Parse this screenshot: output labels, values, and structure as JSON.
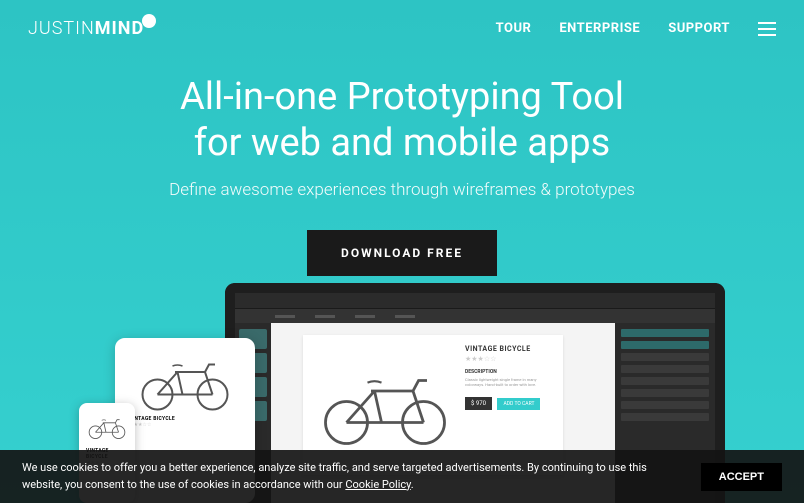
{
  "brand": {
    "prefix": "JUSTIN",
    "suffix": "MIND"
  },
  "nav": {
    "tour": "TOUR",
    "enterprise": "ENTERPRISE",
    "support": "SUPPORT"
  },
  "hero": {
    "title_line1": "All-in-one Prototyping Tool",
    "title_line2": "for web and mobile apps",
    "subtitle": "Define awesome experiences through wireframes & prototypes",
    "cta": "DOWNLOAD FREE"
  },
  "product": {
    "title": "VINTAGE BICYCLE",
    "desc_label": "DESCRIPTION",
    "desc_text": "Classic lightweight single frame in many colorways. Hand-built to order with love.",
    "price": "$ 970",
    "add": "ADD TO CART"
  },
  "cookie": {
    "text_before": "We use cookies to offer you a better experience, analyze site traffic, and serve targeted advertisements. By continuing to use this website, you consent to the use of cookies in accordance with our ",
    "link": "Cookie Policy",
    "text_after": ".",
    "accept": "ACCEPT"
  }
}
